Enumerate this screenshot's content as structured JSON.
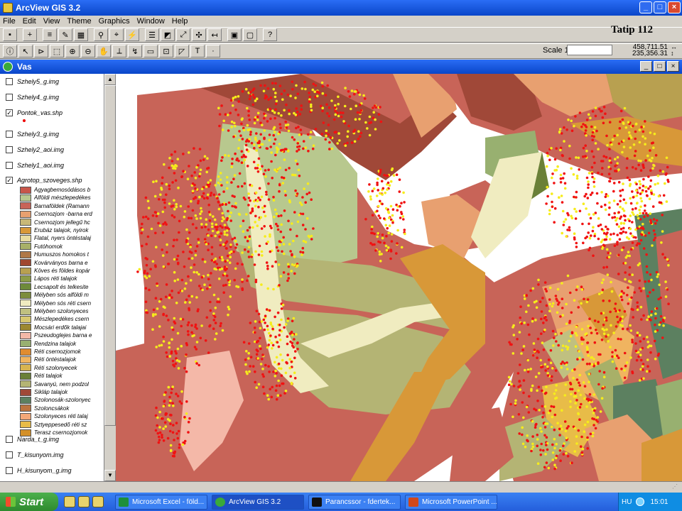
{
  "app": {
    "title": "ArcView GIS 3.2"
  },
  "menu": [
    "File",
    "Edit",
    "View",
    "Theme",
    "Graphics",
    "Window",
    "Help"
  ],
  "annotation": "Tatip 112",
  "scale": {
    "label": "Scale 1:",
    "value": ""
  },
  "coords": {
    "x": "458,711.51",
    "y": "235,356.31"
  },
  "view": {
    "title": "Vas"
  },
  "layers": [
    {
      "name": "Szhely5_g.img",
      "checked": false
    },
    {
      "name": "Szhely4_g.img",
      "checked": false
    },
    {
      "name": "Pontok_vas.shp",
      "checked": true
    },
    {
      "name": "Szhely3_g.img",
      "checked": false
    },
    {
      "name": "Szhely2_aoi.img",
      "checked": false
    },
    {
      "name": "Szhely1_aoi.img",
      "checked": false
    },
    {
      "name": "Agrotop_szoveges.shp",
      "checked": true
    },
    {
      "name": "Narda_t_g.img",
      "checked": false
    },
    {
      "name": "T_kisunyom.img",
      "checked": false
    },
    {
      "name": "H_kisunyom_g.img",
      "checked": false
    }
  ],
  "legend": [
    {
      "label": "Agyagbemosódásos b",
      "color": "#c8564a"
    },
    {
      "label": "Alföldi mészlepedékes",
      "color": "#b8c88e"
    },
    {
      "label": "Barnaföldek (Ramann",
      "color": "#c86458"
    },
    {
      "label": "Csernozjom -barna erd",
      "color": "#e8a070"
    },
    {
      "label": "Csernozjom jellegű hc",
      "color": "#c8b878"
    },
    {
      "label": "Erubáz talajok, nyirok",
      "color": "#d89838"
    },
    {
      "label": "Flatal, nyers öntéstalaj",
      "color": "#e8dca0"
    },
    {
      "label": "Futóhomok",
      "color": "#a8b068"
    },
    {
      "label": "Humuszos homokos t",
      "color": "#b07848"
    },
    {
      "label": "Kovárványos barna e",
      "color": "#a04830"
    },
    {
      "label": "Köves és földes kopár",
      "color": "#b8a050"
    },
    {
      "label": "Lápos réti talajok",
      "color": "#8c9c48"
    },
    {
      "label": "Lecsapolt és telkesite",
      "color": "#6e8a3a"
    },
    {
      "label": "Mélyben sós alföldi m",
      "color": "#7c8c3c"
    },
    {
      "label": "Mélyben sós réti csern",
      "color": "#f0ecc0"
    },
    {
      "label": "Mélyben szolonyeces",
      "color": "#c0c080"
    },
    {
      "label": "Mészlepedékes csern",
      "color": "#d8c870"
    },
    {
      "label": "Mocsári erdők talajai",
      "color": "#9c8830"
    },
    {
      "label": "Pszeudoglejes barna e",
      "color": "#f4b8a8"
    },
    {
      "label": "Rendzina talajok",
      "color": "#98b070"
    },
    {
      "label": "Réti csernozjomok",
      "color": "#e08c30"
    },
    {
      "label": "Réti öntéstalajok",
      "color": "#f0b460"
    },
    {
      "label": "Réti szolonyecek",
      "color": "#d8b450"
    },
    {
      "label": "Réti talajok",
      "color": "#6a8038"
    },
    {
      "label": "Savanyú, nem podzol",
      "color": "#b4b474"
    },
    {
      "label": "Sikláp talajok",
      "color": "#a04838"
    },
    {
      "label": "Szolonosák-szolonyec",
      "color": "#5c8060"
    },
    {
      "label": "Szoloncsákok",
      "color": "#bc7440"
    },
    {
      "label": "Szolonyeces réti talaj",
      "color": "#f4a878"
    },
    {
      "label": "Sztyeppesedő réti sz",
      "color": "#e8bc48"
    },
    {
      "label": "Terasz csernozjomok",
      "color": "#d49028"
    }
  ],
  "taskbar": {
    "start": "Start",
    "tasks": [
      "Microsoft Excel - föld...",
      "ArcView GIS 3.2",
      "Parancssor - fdertek...",
      "Microsoft PowerPoint ..."
    ],
    "lang": "HU",
    "time": "15:01"
  }
}
